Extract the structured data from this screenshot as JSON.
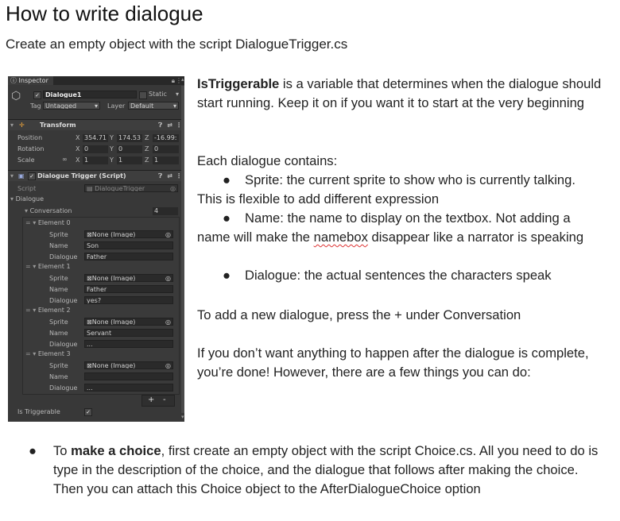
{
  "title": "How to write dialogue",
  "subtitle": "Create an empty object with the script DialogueTrigger.cs",
  "inspector": {
    "tab": "Inspector",
    "object_name": "Dialogue1",
    "static_label": "Static",
    "tag_label": "Tag",
    "tag_value": "Untagged",
    "layer_label": "Layer",
    "layer_value": "Default",
    "transform_title": "Transform",
    "position_label": "Position",
    "position": {
      "x": "354.71",
      "y": "174.53",
      "z": "-16.99:"
    },
    "rotation_label": "Rotation",
    "rotation": {
      "x": "0",
      "y": "0",
      "z": "0"
    },
    "scale_label": "Scale",
    "scale": {
      "x": "1",
      "y": "1",
      "z": "1"
    },
    "axis": {
      "x": "X",
      "y": "Y",
      "z": "Z"
    },
    "component_title": "Dialogue Trigger (Script)",
    "script_label": "Script",
    "script_value": "DialogueTrigger",
    "dialogue_label": "Dialogue",
    "conversation_label": "Conversation",
    "conversation_count": "4",
    "sprite_label": "Sprite",
    "name_label": "Name",
    "dialogue_field_label": "Dialogue",
    "none_image": "None (Image)",
    "elements": [
      {
        "label": "Element 0",
        "name": "Son",
        "dialogue": "Father"
      },
      {
        "label": "Element 1",
        "name": "Father",
        "dialogue": "yes?"
      },
      {
        "label": "Element 2",
        "name": "Servant",
        "dialogue": "..."
      },
      {
        "label": "Element 3",
        "name": "",
        "dialogue": "..."
      }
    ],
    "plus": "+",
    "minus": "-",
    "is_triggerable_label": "Is Triggerable",
    "check": "✓"
  },
  "text": {
    "p1_bold": "IsTriggerable",
    "p1_rest": " is a variable that determines when the dialogue should start running. Keep it on if you want it to start at the very beginning",
    "p2": "Each dialogue contains:",
    "b1": "Sprite: the current sprite to show who is currently talking. This is flexible to add different expression",
    "b2_a": "Name: the name to display on the textbox. Not adding a name will make the ",
    "b2_squig": "namebox",
    "b2_b": " disappear like a narrator is speaking",
    "b3": "Dialogue: the actual sentences the characters speak",
    "p3": "To add a new dialogue, press the + under Conversation",
    "p4": "If you don’t want anything to happen after the dialogue is complete, you’re done! However, there are a few things you can do:",
    "bottom_a": "To ",
    "bottom_bold": "make a choice",
    "bottom_b": ", first create an empty object with the script Choice.cs. All you need to do is type in the description of the choice, and the dialogue that follows after making the choice. Then you can attach this Choice object to the AfterDialogueChoice option"
  },
  "colors": {
    "panel": "#383838",
    "field": "#2a2a2a",
    "squiggle": "#d33333"
  }
}
